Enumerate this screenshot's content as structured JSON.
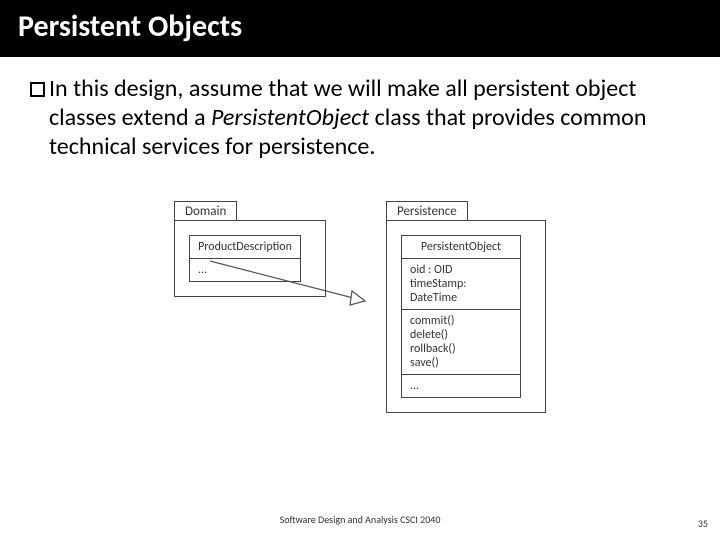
{
  "title": "Persistent Objects",
  "body": {
    "prefix": "In",
    "rest": " this design, assume that we will make all persistent object classes extend a ",
    "className": "PersistentObject",
    "tail": " class that provides common technical services for persistence."
  },
  "diagram": {
    "left": {
      "packageLabel": "Domain",
      "className": "ProductDescription",
      "ellipsis": "..."
    },
    "right": {
      "packageLabel": "Persistence",
      "className": "PersistentObject",
      "attributes": [
        "oid : OID",
        "timeStamp:",
        "DateTime"
      ],
      "operations": [
        "commit()",
        "delete()",
        "rollback()",
        "save()"
      ],
      "ellipsis": "..."
    }
  },
  "footer": "Software Design and Analysis CSCI 2040",
  "pageNumber": "35"
}
